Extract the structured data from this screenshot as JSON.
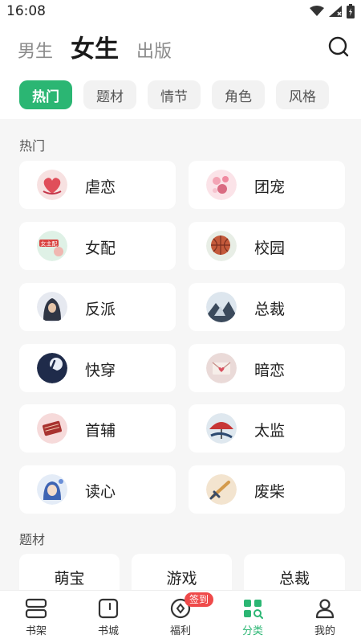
{
  "status": {
    "time": "16:08"
  },
  "top_tabs": [
    {
      "label": "男生"
    },
    {
      "label": "女生"
    },
    {
      "label": "出版"
    }
  ],
  "filters": [
    {
      "label": "热门"
    },
    {
      "label": "题材"
    },
    {
      "label": "情节"
    },
    {
      "label": "角色"
    },
    {
      "label": "风格"
    }
  ],
  "hot_section": {
    "title": "热门",
    "items": [
      {
        "label": "虐恋",
        "icon": "heart-pile-icon"
      },
      {
        "label": "团宠",
        "icon": "pink-flower-girl-icon"
      },
      {
        "label": "女配",
        "icon": "supporting-girl-icon",
        "icon_text": "女主配"
      },
      {
        "label": "校园",
        "icon": "basketball-icon"
      },
      {
        "label": "反派",
        "icon": "hooded-villain-icon"
      },
      {
        "label": "总裁",
        "icon": "ceo-landscape-icon"
      },
      {
        "label": "快穿",
        "icon": "dancer-silhouette-icon"
      },
      {
        "label": "暗恋",
        "icon": "love-letter-icon"
      },
      {
        "label": "首辅",
        "icon": "scroll-icon"
      },
      {
        "label": "太监",
        "icon": "red-umbrella-icon"
      },
      {
        "label": "读心",
        "icon": "girl-head-icon"
      },
      {
        "label": "废柴",
        "icon": "broken-sword-icon"
      }
    ]
  },
  "theme_section": {
    "title": "题材",
    "items": [
      {
        "label": "萌宝"
      },
      {
        "label": "游戏"
      },
      {
        "label": "总裁"
      }
    ]
  },
  "bottom_nav": [
    {
      "label": "书架",
      "icon": "bookshelf-icon"
    },
    {
      "label": "书城",
      "icon": "bookstore-icon"
    },
    {
      "label": "福利",
      "icon": "welfare-icon",
      "badge": "签到"
    },
    {
      "label": "分类",
      "icon": "category-icon"
    },
    {
      "label": "我的",
      "icon": "profile-icon"
    }
  ],
  "colors": {
    "accent": "#2bb673",
    "badge": "#ef4a4a"
  }
}
